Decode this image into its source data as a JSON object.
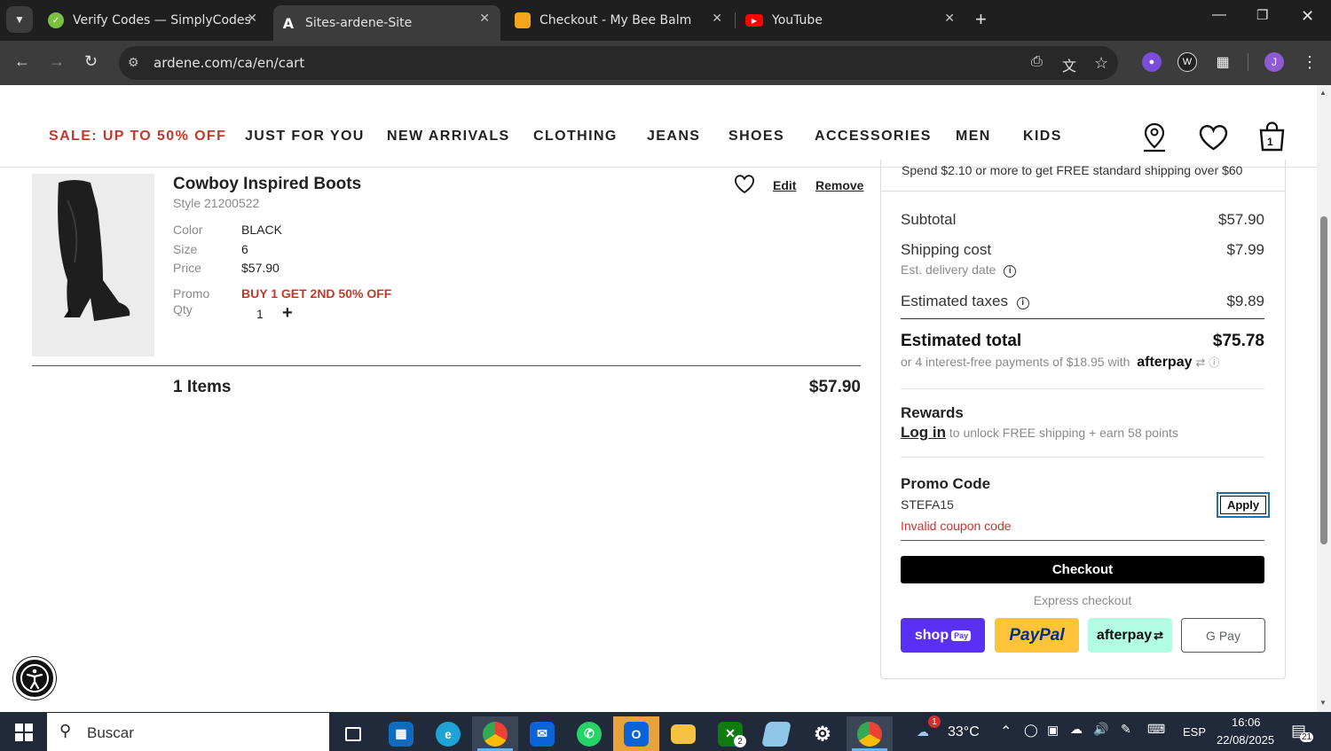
{
  "browser": {
    "tabs": [
      {
        "title": "Verify Codes — SimplyCodes",
        "active": false
      },
      {
        "title": "Sites-ardene-Site",
        "active": true
      },
      {
        "title": "Checkout - My Bee Balm",
        "active": false
      },
      {
        "title": "YouTube",
        "active": false
      }
    ],
    "url": "ardene.com/ca/en/cart",
    "profile_initial": "J"
  },
  "site_nav": {
    "items": [
      "SALE: UP TO 50% OFF",
      "JUST FOR YOU",
      "NEW ARRIVALS",
      "CLOTHING",
      "JEANS",
      "SHOES",
      "ACCESSORIES",
      "MEN",
      "KIDS"
    ],
    "cart_count": "1",
    "sale_color": "#c0392b"
  },
  "cart_item": {
    "name": "Cowboy Inspired Boots",
    "style": "Style 21200522",
    "color_label": "Color",
    "color_value": "BLACK",
    "size_label": "Size",
    "size_value": "6",
    "price_label": "Price",
    "price_value": "$57.90",
    "promo_label": "Promo",
    "promo_value": "BUY 1 GET 2ND 50% OFF",
    "qty_label": "Qty",
    "qty_value": "1",
    "qty_plus": "+",
    "edit": "Edit",
    "remove": "Remove"
  },
  "items_summary": {
    "count": "1 Items",
    "total": "$57.90"
  },
  "order_summary": {
    "shipping_banner": "Spend $2.10 or more to get FREE standard shipping over $60",
    "subtotal_label": "Subtotal",
    "subtotal_value": "$57.90",
    "shipping_label": "Shipping cost",
    "shipping_value": "$7.99",
    "delivery_label": "Est. delivery date",
    "taxes_label": "Estimated taxes",
    "taxes_value": "$9.89",
    "total_label": "Estimated total",
    "total_value": "$75.78",
    "installments": "or 4 interest-free payments of $18.95 with",
    "afterpay_logo": "afterpay",
    "rewards_title": "Rewards",
    "login_link": "Log in",
    "rewards_text": "to unlock FREE shipping + earn 58 points",
    "promo_title": "Promo Code",
    "promo_code": "STEFA15",
    "apply": "Apply",
    "promo_error": "Invalid coupon code",
    "checkout": "Checkout",
    "express_label": "Express checkout",
    "shoppay": "shop",
    "shoppay_badge": "Pay",
    "paypal": "PayPal",
    "afterpay_btn": "afterpay",
    "gpay": "G Pay"
  },
  "taskbar": {
    "search_placeholder": "Buscar",
    "weather_temp": "33°C",
    "weather_badge": "1",
    "language": "ESP",
    "time": "16:06",
    "date": "22/08/2025",
    "notifications": "21",
    "xbox_badge": "2"
  }
}
